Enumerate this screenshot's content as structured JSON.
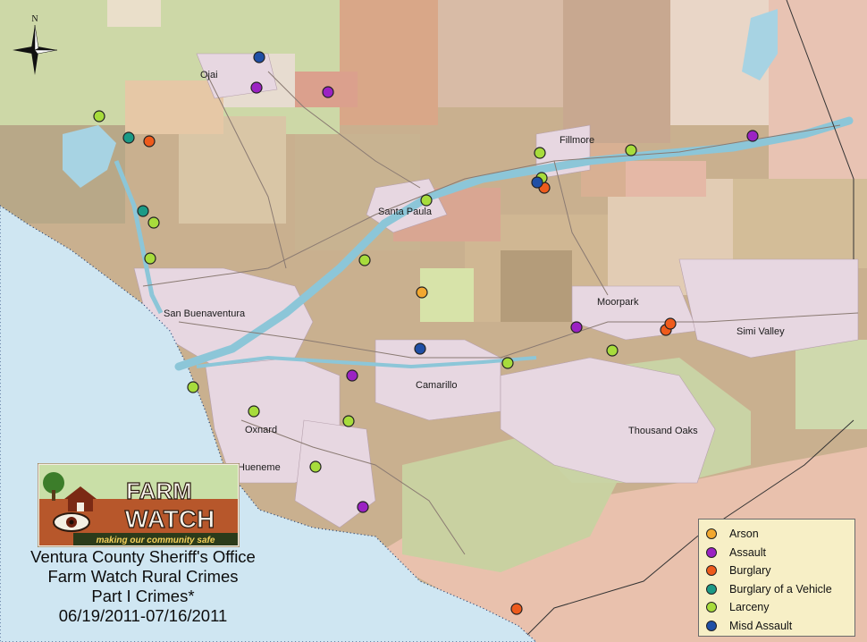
{
  "map": {
    "compass_label": "N",
    "cities": [
      {
        "id": "ojai",
        "name": "Ojai"
      },
      {
        "id": "fillmore",
        "name": "Fillmore"
      },
      {
        "id": "santa-paula",
        "name": "Santa Paula"
      },
      {
        "id": "san-buenaventura",
        "name": "San Buenaventura"
      },
      {
        "id": "moorpark",
        "name": "Moorpark"
      },
      {
        "id": "simi-valley",
        "name": "Simi Valley"
      },
      {
        "id": "camarillo",
        "name": "Camarillo"
      },
      {
        "id": "oxnard",
        "name": "Oxnard"
      },
      {
        "id": "thousand-oaks",
        "name": "Thousand Oaks"
      },
      {
        "id": "hueneme",
        "name": "Hueneme"
      }
    ]
  },
  "colors": {
    "ocean": "#cfe6f2",
    "land": "#c7ad8c",
    "urban": "#e7d8e2",
    "river": "#8cc6d8",
    "arson": "#f2a830",
    "assault": "#9b22c3",
    "burglary": "#ee5b1c",
    "burglary_vehicle": "#1c9a86",
    "larceny": "#a7dc3c",
    "misd_assault": "#1f4fa6"
  },
  "legend": {
    "items": [
      {
        "label": "Arson",
        "color": "#f2a830"
      },
      {
        "label": "Assault",
        "color": "#9b22c3"
      },
      {
        "label": "Burglary",
        "color": "#ee5b1c"
      },
      {
        "label": "Burglary of a Vehicle",
        "color": "#1c9a86"
      },
      {
        "label": "Larceny",
        "color": "#a7dc3c"
      },
      {
        "label": "Misd Assault",
        "color": "#1f4fa6"
      }
    ]
  },
  "logo": {
    "line1": "FARM",
    "line2": "WATCH",
    "tagline": "making our community safe"
  },
  "title": {
    "line1": "Ventura County Sheriff's Office",
    "line2": "Farm Watch Rural Crimes",
    "line3": "Part I Crimes*",
    "line4": "06/19/2011-07/16/2011"
  },
  "incidents_count": 33
}
